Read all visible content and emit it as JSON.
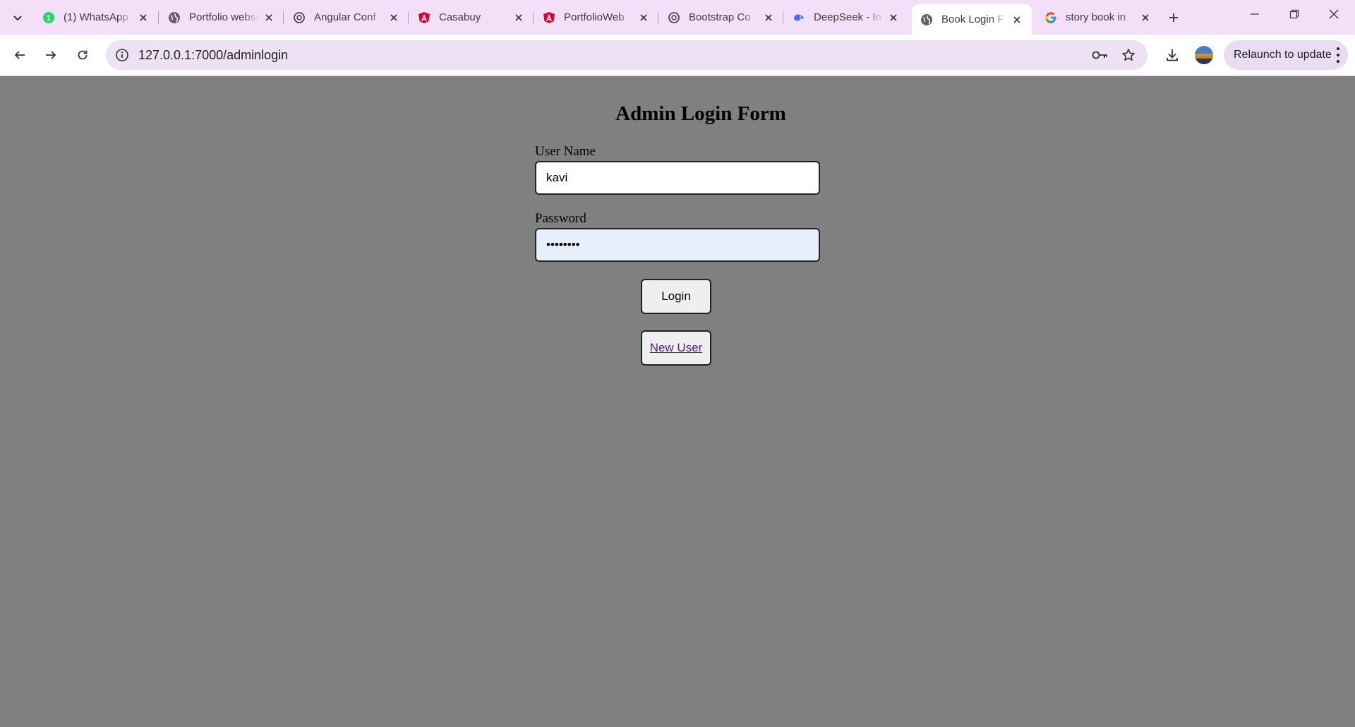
{
  "tabs": [
    {
      "title": "(1) WhatsApp",
      "icon": "whatsapp-icon",
      "active": false
    },
    {
      "title": "Portfolio website",
      "icon": "globe-icon",
      "active": false
    },
    {
      "title": "Angular Conf",
      "icon": "chatgpt-icon",
      "active": false
    },
    {
      "title": "Casabuy",
      "icon": "angular-icon",
      "active": false
    },
    {
      "title": "PortfolioWeb",
      "icon": "angular-icon",
      "active": false
    },
    {
      "title": "Bootstrap Co",
      "icon": "chatgpt-icon",
      "active": false
    },
    {
      "title": "DeepSeek - In",
      "icon": "deepseek-icon",
      "active": false
    },
    {
      "title": "Book Login F",
      "icon": "globe-icon",
      "active": true
    },
    {
      "title": "story book in",
      "icon": "google-icon",
      "active": false
    }
  ],
  "toolbar": {
    "url": "127.0.0.1:7000/adminlogin",
    "relaunch_label": "Relaunch to update"
  },
  "form": {
    "title": "Admin Login Form",
    "username_label": "User Name",
    "username_value": "kavi",
    "password_label": "Password",
    "password_value": "••••••••",
    "login_label": "Login",
    "new_user_label": "New User"
  },
  "colors": {
    "tabstrip_bg": "#f3dff8",
    "page_bg": "#808080",
    "autofill_bg": "#e8f0fe",
    "link": "#551a8b"
  }
}
